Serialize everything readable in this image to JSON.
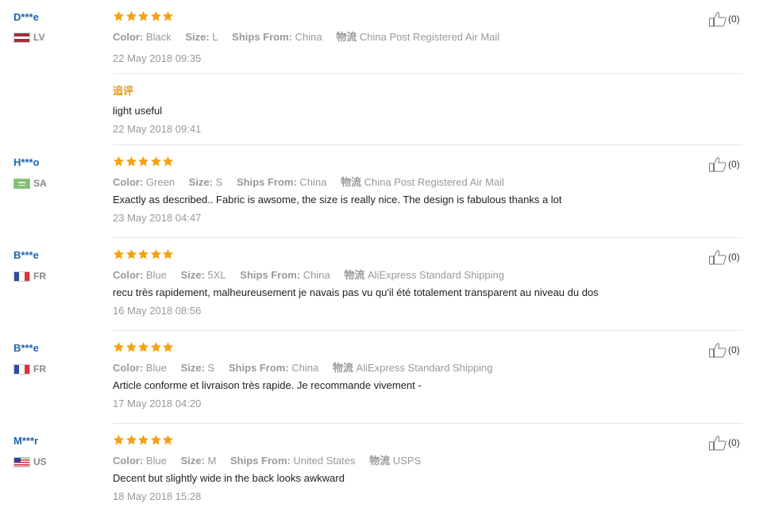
{
  "labels": {
    "color": "Color:",
    "size": "Size:",
    "ships_from": "Ships From:",
    "logistics": "物流"
  },
  "colors": {
    "star": "#f6a210",
    "username": "#1c64b0",
    "followup": "#e89a10",
    "muted": "#999999"
  },
  "reviews": [
    {
      "user": "D***e",
      "country": "LV",
      "flag": "latvia-flag",
      "rating": 5,
      "color": "Black",
      "size": "L",
      "ships_from": "China",
      "shipping": "China Post Registered Air Mail",
      "text": "",
      "date": "22 May 2018 09:35",
      "followup_label": "追评",
      "followup_text": "light useful",
      "followup_date": "22 May 2018 09:41",
      "likes": "(0)"
    },
    {
      "user": "H***o",
      "country": "SA",
      "flag": "saudi-arabia-flag",
      "rating": 5,
      "color": "Green",
      "size": "S",
      "ships_from": "China",
      "shipping": "China Post Registered Air Mail",
      "text": "Exactly as described.. Fabric is awsome, the size is really nice. The design is fabulous thanks a lot",
      "date": "23 May 2018 04:47",
      "likes": "(0)"
    },
    {
      "user": "B***e",
      "country": "FR",
      "flag": "france-flag",
      "rating": 5,
      "color": "Blue",
      "size": "5XL",
      "ships_from": "China",
      "shipping": "AliExpress Standard Shipping",
      "text": "recu très rapidement, malheureusement je navais pas vu qu'il été totalement transparent au niveau du dos",
      "date": "16 May 2018 08:56",
      "likes": "(0)"
    },
    {
      "user": "B***e",
      "country": "FR",
      "flag": "france-flag",
      "rating": 5,
      "color": "Blue",
      "size": "S",
      "ships_from": "China",
      "shipping": "AliExpress Standard Shipping",
      "text": "Article conforme et livraison très rapide. Je recommande vivement -",
      "date": "17 May 2018 04:20",
      "likes": "(0)"
    },
    {
      "user": "M***r",
      "country": "US",
      "flag": "usa-flag",
      "rating": 5,
      "color": "Blue",
      "size": "M",
      "ships_from": "United States",
      "shipping": "USPS",
      "text": "Decent but slightly wide in the back looks awkward",
      "date": "18 May 2018 15:28",
      "likes": "(0)"
    }
  ]
}
